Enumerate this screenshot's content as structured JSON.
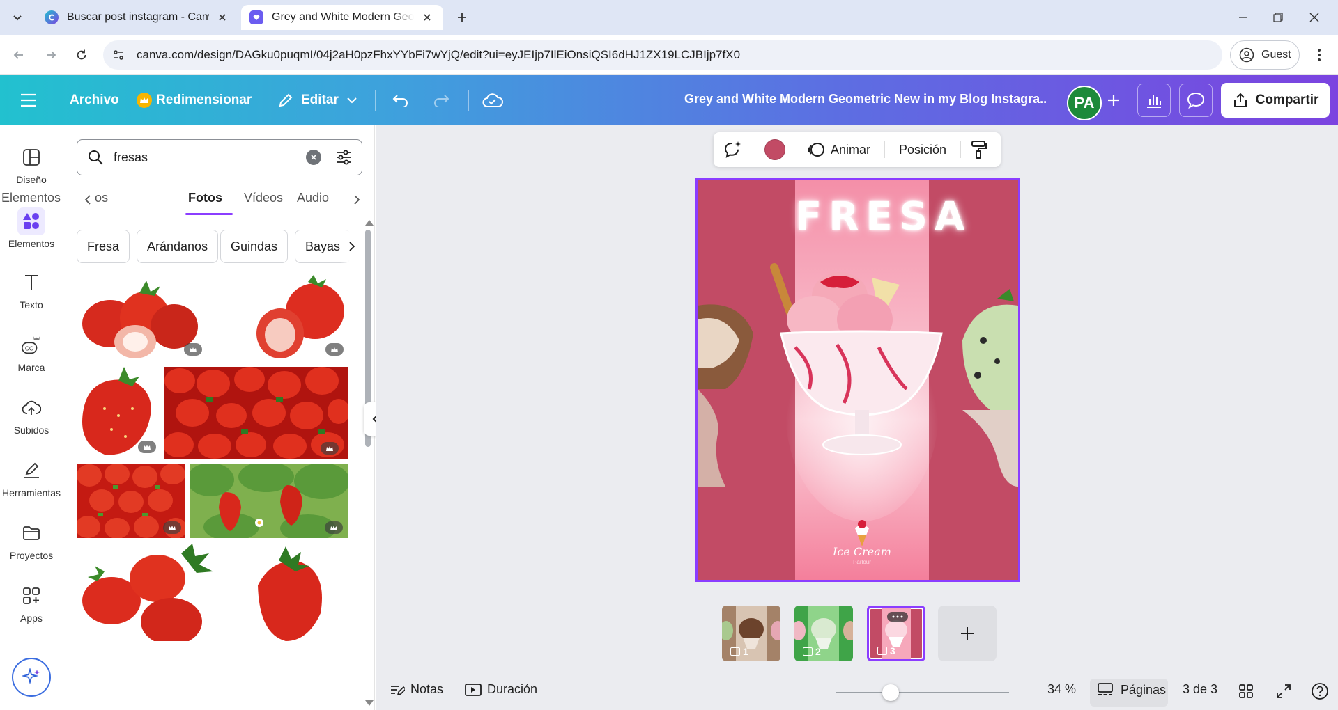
{
  "browser": {
    "tabs": [
      {
        "title": "Buscar post instagram - Canva",
        "active": false
      },
      {
        "title": "Grey and White Modern Geometric New in my Blog Instagram Post",
        "active": true
      }
    ],
    "url": "canva.com/design/DAGku0puqmI/04j2aH0pzFhxYYbFi7wYjQ/edit?ui=eyJEIjp7IlEiOnsiQSI6dHJ1ZX19LCJBIjp7fX0",
    "profile_label": "Guest"
  },
  "header": {
    "file_label": "Archivo",
    "resize_label": "Redimensionar",
    "edit_label": "Editar",
    "doc_title": "Grey and White Modern Geometric New in my Blog Instagra...",
    "avatar_initials": "PA",
    "share_label": "Compartir",
    "brand_gradient": [
      "#22c1cf",
      "#5c6fe2",
      "#7b43e0"
    ]
  },
  "rail": {
    "items": [
      {
        "label": "Diseño",
        "icon": "layout-icon"
      },
      {
        "label": "Elementos",
        "icon": "shapes-icon"
      },
      {
        "label": "Texto",
        "icon": "text-icon"
      },
      {
        "label": "Marca",
        "icon": "brand-icon"
      },
      {
        "label": "Subidos",
        "icon": "upload-cloud-icon"
      },
      {
        "label": "Herramientas",
        "icon": "draw-tools-icon"
      },
      {
        "label": "Proyectos",
        "icon": "folder-icon"
      },
      {
        "label": "Apps",
        "icon": "apps-grid-icon"
      }
    ]
  },
  "panel": {
    "search_value": "fresas",
    "tabs": [
      "Elementos gráficos",
      "Fotos",
      "Vídeos",
      "Audio"
    ],
    "active_tab": "Fotos",
    "chips": [
      "Fresa",
      "Arándanos",
      "Guindas",
      "Bayas"
    ],
    "accent": "#8b3dff"
  },
  "context_toolbar": {
    "color": "#c24b65",
    "animate_label": "Animar",
    "position_label": "Posición"
  },
  "canvas": {
    "heading": "FRESA",
    "logo_text": "Ice Cream",
    "logo_subtext": "Parlour"
  },
  "pages": {
    "thumbs": [
      {
        "num": "1"
      },
      {
        "num": "2"
      },
      {
        "num": "3"
      }
    ]
  },
  "bottom": {
    "notes_label": "Notas",
    "duration_label": "Duración",
    "zoom": "34 %",
    "zoom_fraction": 0.34,
    "pages_label": "Páginas",
    "page_count": "3 de 3"
  }
}
